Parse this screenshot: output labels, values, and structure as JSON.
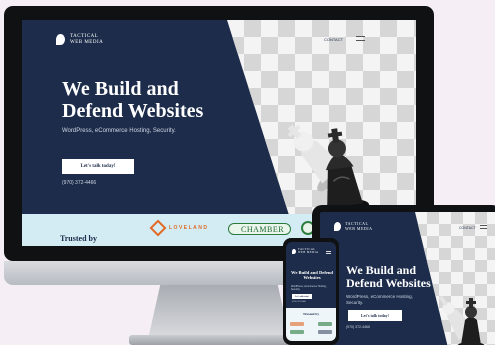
{
  "brand": {
    "line1": "TACTICAL",
    "line2": "WEB MEDIA"
  },
  "nav": {
    "contact": "CONTACT"
  },
  "hero": {
    "headline": "We Build and Defend Websites",
    "subtext": "WordPress, eCommerce Hosting, Security.",
    "cta": "Let's talk today!",
    "phone": "(970) 372-4466"
  },
  "trusted": {
    "label": "Trusted by",
    "partners": {
      "loveland": "LOVELAND",
      "chamber": "CHAMBER"
    }
  },
  "colors": {
    "navy": "#1c2c4a",
    "trusted_bg": "#d3ecf4",
    "loveland": "#e06a24",
    "chamber": "#1d6a30"
  }
}
